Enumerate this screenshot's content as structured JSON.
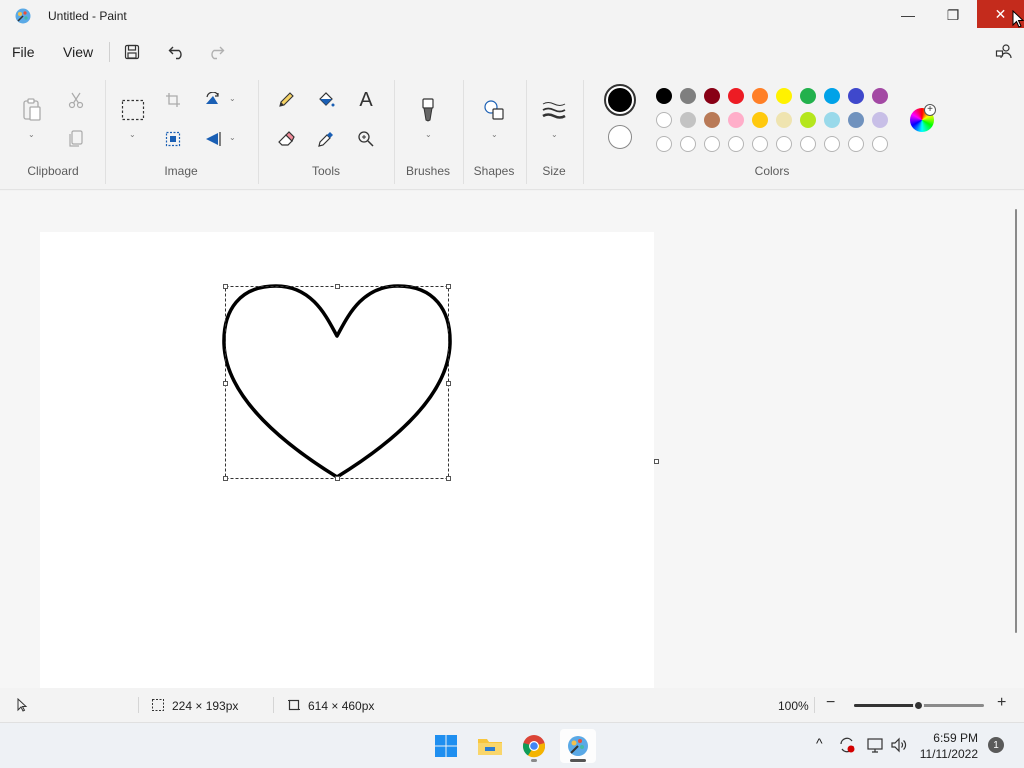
{
  "window": {
    "title": "Untitled - Paint",
    "min_glyph": "—",
    "max_glyph": "❐",
    "close_glyph": "✕"
  },
  "menu": {
    "file": "File",
    "view": "View"
  },
  "ribbon": {
    "groups": {
      "clipboard": "Clipboard",
      "image": "Image",
      "tools": "Tools",
      "brushes": "Brushes",
      "shapes": "Shapes",
      "size": "Size",
      "colors": "Colors"
    },
    "text_tool_glyph": "A"
  },
  "colors": {
    "primary": "#000000",
    "secondary": "#ffffff",
    "palette_row1": [
      "#000000",
      "#7f7f7f",
      "#880015",
      "#ed1c24",
      "#ff7f27",
      "#fff200",
      "#22b14c",
      "#00a2e8",
      "#3f48cc",
      "#a349a4"
    ],
    "palette_row2": [
      "#ffffff",
      "#c3c3c3",
      "#b97a57",
      "#ffaec9",
      "#ffc90e",
      "#efe4b0",
      "#b5e61d",
      "#99d9ea",
      "#7092be",
      "#c8bfe7"
    ],
    "palette_row3_count": 10
  },
  "status": {
    "selection_size": "224 × 193px",
    "canvas_size": "614 × 460px",
    "zoom": "100%",
    "zoom_level_fraction": 0.5
  },
  "taskbar": {
    "time": "6:59 PM",
    "date": "11/11/2022",
    "notifications": "1"
  }
}
